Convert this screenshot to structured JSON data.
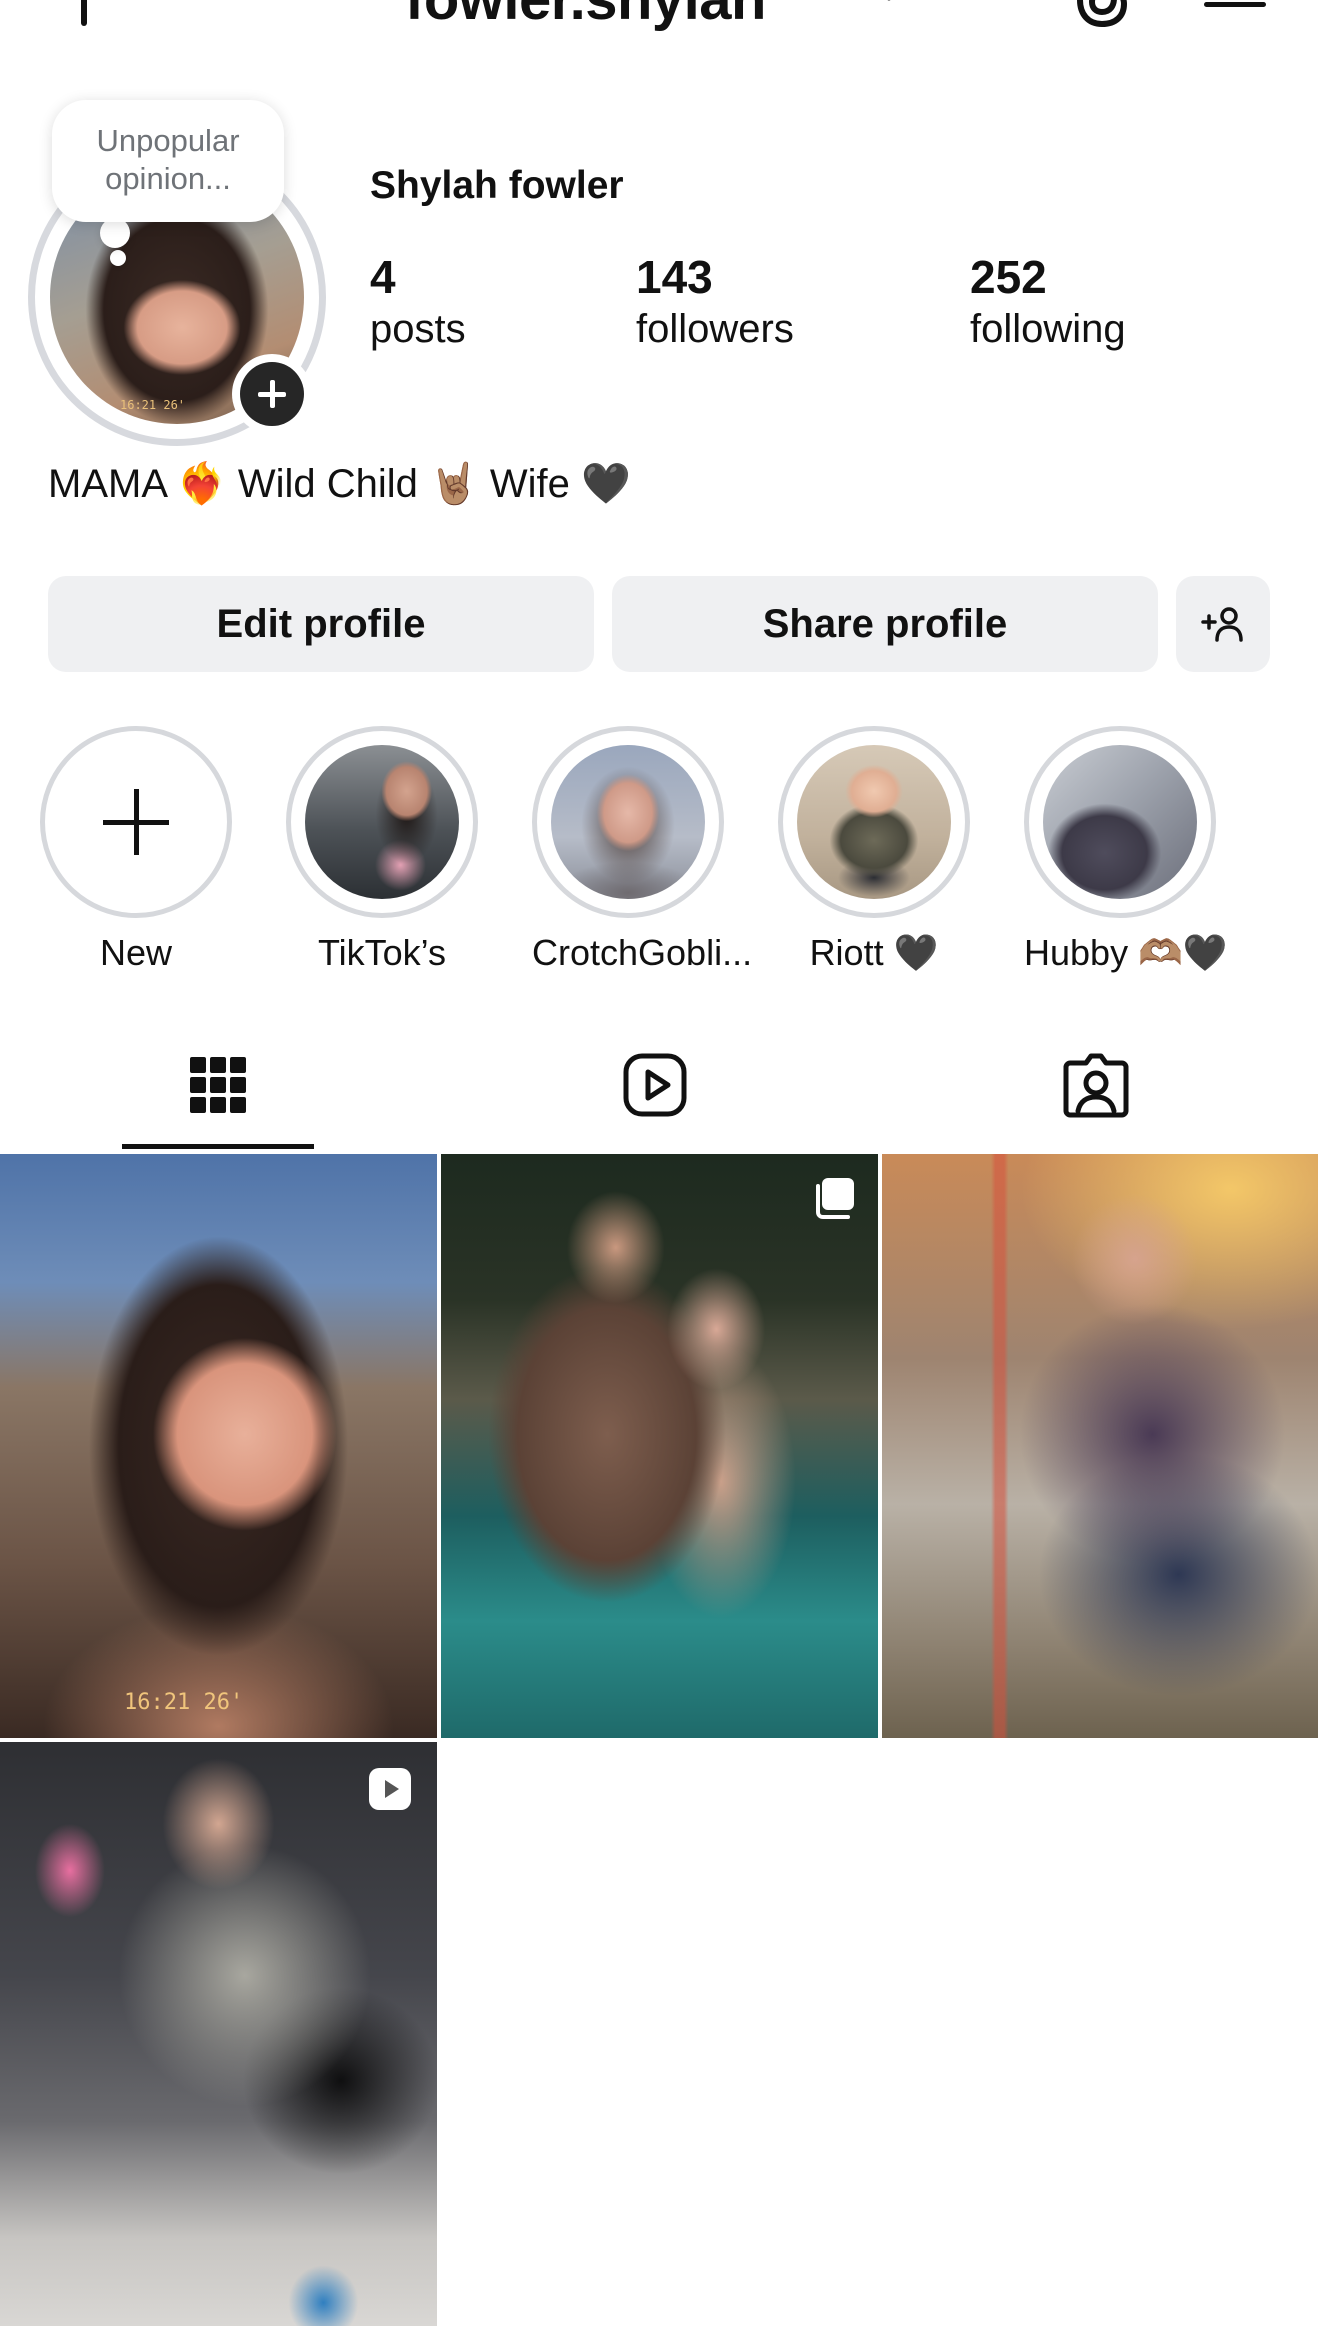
{
  "topbar": {
    "username": "fowler.shylah",
    "icons": [
      "plus-icon",
      "chevron-down-icon",
      "threads-icon",
      "menu-icon"
    ]
  },
  "profile": {
    "note": "Unpopular opinion...",
    "display_name": "Shylah fowler",
    "stats": {
      "posts": {
        "value": "4",
        "label": "posts"
      },
      "followers": {
        "value": "143",
        "label": "followers"
      },
      "following": {
        "value": "252",
        "label": "following"
      }
    },
    "bio": "MAMA ❤️‍🔥 Wild Child 🤘🏽 Wife 🖤"
  },
  "actions": {
    "edit_profile": "Edit profile",
    "share_profile": "Share profile",
    "discover_people_icon": "add-person-icon"
  },
  "highlights": [
    {
      "label": "New"
    },
    {
      "label": "TikTok’s"
    },
    {
      "label": "CrotchGobli..."
    },
    {
      "label": "Riott 🖤"
    },
    {
      "label": "Hubby 🫶🏽🖤"
    }
  ],
  "tabs": [
    {
      "name": "posts-grid",
      "icon": "grid-icon",
      "active": true
    },
    {
      "name": "reels",
      "icon": "reels-icon",
      "active": false
    },
    {
      "name": "tagged",
      "icon": "tagged-icon",
      "active": false
    }
  ],
  "posts": [
    {
      "type": "photo",
      "overlay": "16:21  26'"
    },
    {
      "type": "carousel"
    },
    {
      "type": "photo"
    },
    {
      "type": "reel"
    }
  ],
  "colors": {
    "button_bg": "#eff0f2",
    "ring": "#d7d9de",
    "text": "#111111"
  }
}
